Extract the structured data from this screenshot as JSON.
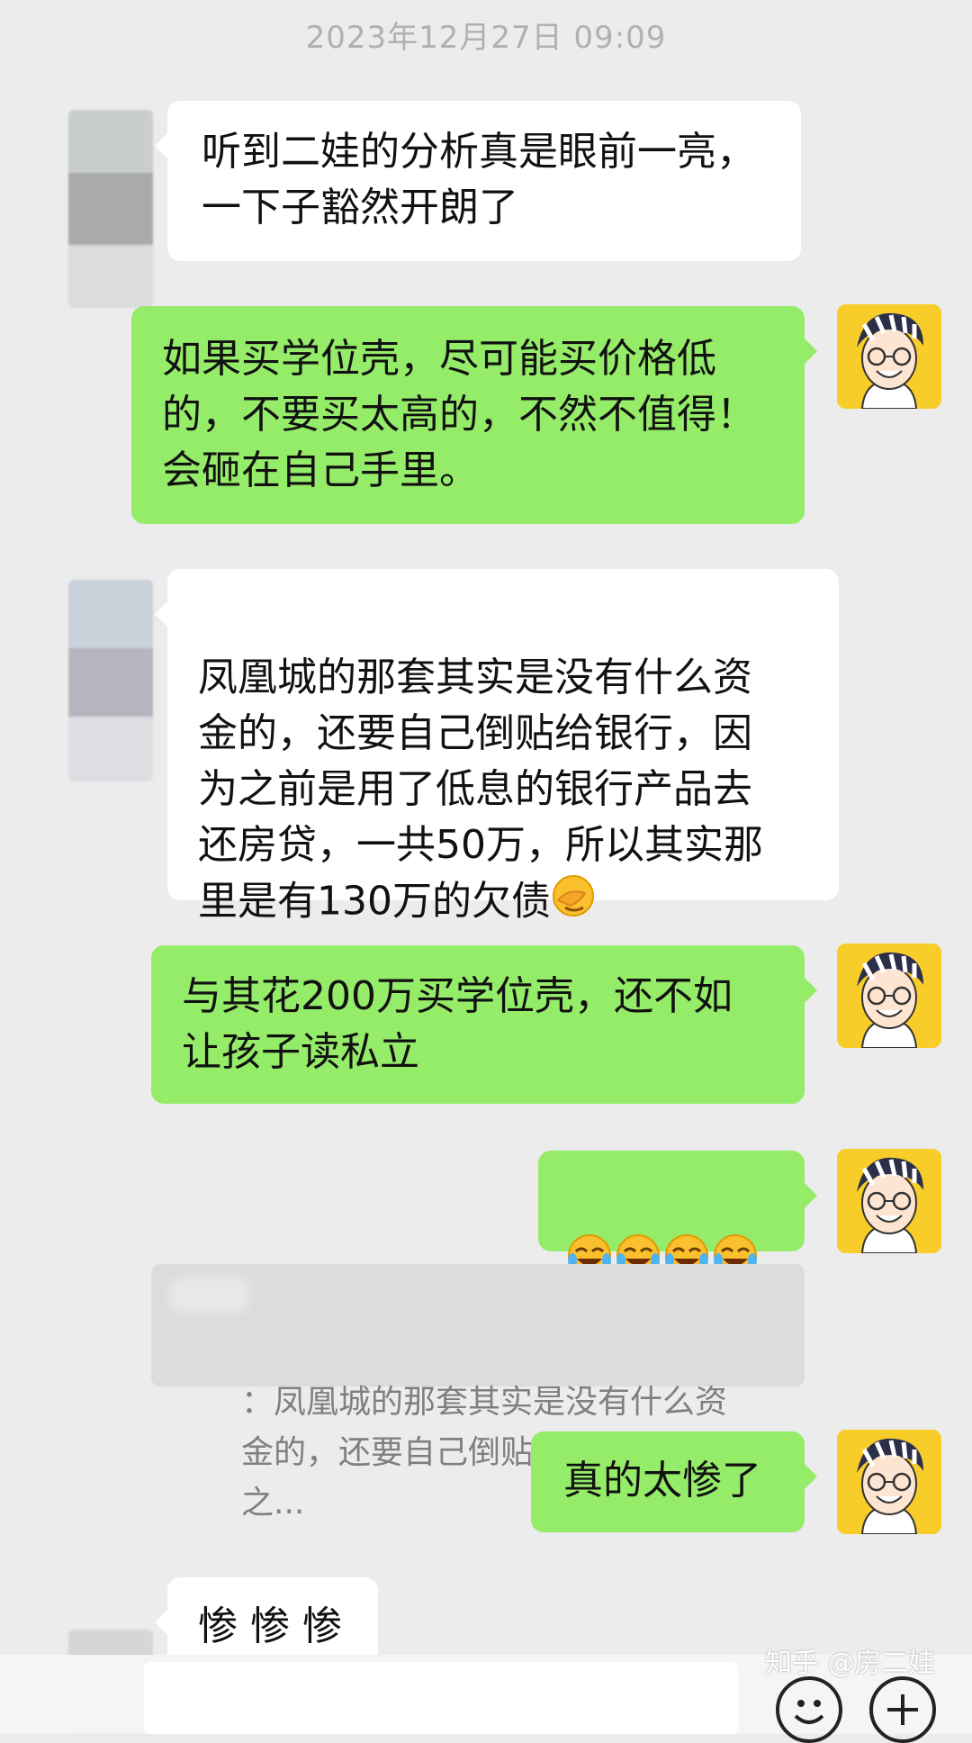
{
  "chat": {
    "timestamp": "2023年12月27日 09:09",
    "messages": [
      {
        "side": "left",
        "text": "听到二娃的分析真是眼前一亮，\n一下子豁然开朗了"
      },
      {
        "side": "right",
        "text": "如果买学位壳，尽可能买价格低\n的，不要买太高的，不然不值得！\n会砸在自己手里。"
      },
      {
        "side": "left",
        "text": "凤凰城的那套其实是没有什么资\n金的，还要自己倒贴给银行，因\n为之前是用了低息的银行产品去\n还房贷，一共50万，所以其实那\n里是有130万的欠债",
        "trailing_emoji": "facepalm-emoji"
      },
      {
        "side": "right",
        "text": "与其花200万买学位壳，还不如\n让孩子读私立"
      },
      {
        "side": "right",
        "emojis": [
          "tears-of-joy-emoji",
          "tears-of-joy-emoji",
          "tears-of-joy-emoji",
          "tears-of-joy-emoji"
        ]
      },
      {
        "side": "right",
        "text": "真的太惨了"
      },
      {
        "side": "left",
        "text": "惨 惨 惨"
      }
    ],
    "quote": {
      "text": "：凤凰城的那套其实是没有什么资\n金的，还要自己倒贴给银行，因为之..."
    }
  },
  "watermark": "知乎 @房二娃",
  "colors": {
    "background": "#ececec",
    "sent_bubble": "#95ec69",
    "received_bubble": "#ffffff",
    "avatar_bg": "#f8cd2a"
  }
}
